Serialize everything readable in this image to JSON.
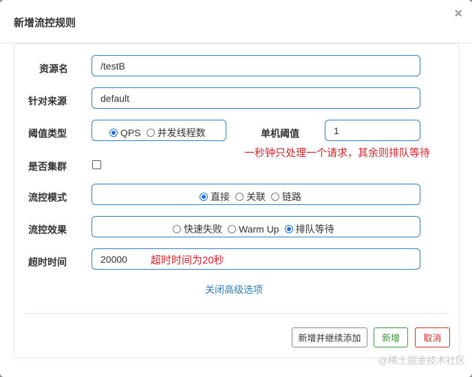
{
  "dialog": {
    "title": "新增流控规则",
    "close_glyph": "×"
  },
  "form": {
    "resource": {
      "label": "资源名",
      "value": "/testB"
    },
    "limit_app": {
      "label": "针对来源",
      "value": "default"
    },
    "threshold_type": {
      "label": "阈值类型",
      "options": [
        "QPS",
        "并发线程数"
      ],
      "selected": "QPS"
    },
    "threshold": {
      "label": "单机阈值",
      "value": "1"
    },
    "cluster": {
      "label": "是否集群",
      "checked": false
    },
    "strategy": {
      "label": "流控模式",
      "options": [
        "直接",
        "关联",
        "链路"
      ],
      "selected": "直接"
    },
    "control_behavior": {
      "label": "流控效果",
      "options": [
        "快速失败",
        "Warm Up",
        "排队等待"
      ],
      "selected": "排队等待"
    },
    "timeout": {
      "label": "超时时间",
      "value": "20000"
    },
    "advanced_toggle": "关闭高级选项"
  },
  "annotations": {
    "threshold_note": "一秒钟只处理一个请求，其余则排队等待",
    "timeout_note": "超时时间为20秒"
  },
  "footer": {
    "add_continue": "新增并继续添加",
    "add": "新增",
    "cancel": "取消"
  },
  "watermark": "@稀土掘金技术社区",
  "colors": {
    "accent": "#2d7eb8",
    "annotation": "#d2232a",
    "success": "#3a9a3a",
    "danger": "#c9302c"
  }
}
